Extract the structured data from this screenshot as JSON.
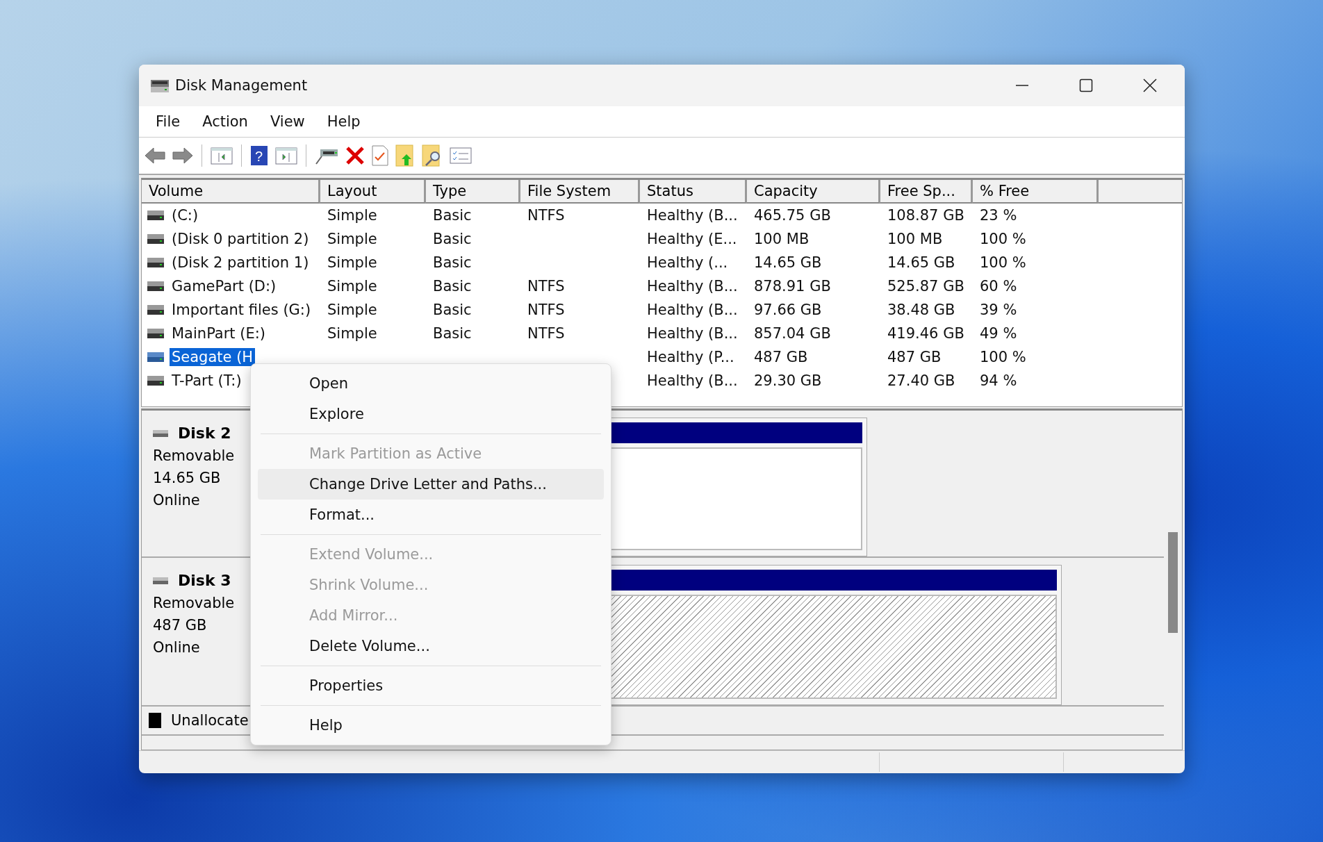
{
  "window": {
    "title": "Disk Management"
  },
  "menu_bar": [
    "File",
    "Action",
    "View",
    "Help"
  ],
  "toolbar": {
    "help_glyph": "?"
  },
  "table": {
    "columns": [
      "Volume",
      "Layout",
      "Type",
      "File System",
      "Status",
      "Capacity",
      "Free Sp...",
      "% Free"
    ],
    "rows": [
      {
        "volume": "(C:)",
        "layout": "Simple",
        "type": "Basic",
        "file_system": "NTFS",
        "status": "Healthy (B...",
        "capacity": "465.75 GB",
        "free_space": "108.87 GB",
        "percent_free": "23 %",
        "selected": false
      },
      {
        "volume": "(Disk 0 partition 2)",
        "layout": "Simple",
        "type": "Basic",
        "status": "Healthy (E...",
        "capacity": "100 MB",
        "free_space": "100 MB",
        "percent_free": "100 %",
        "selected": false
      },
      {
        "volume": "(Disk 2 partition 1)",
        "layout": "Simple",
        "type": "Basic",
        "status": "Healthy (...",
        "capacity": "14.65 GB",
        "free_space": "14.65 GB",
        "percent_free": "100 %",
        "selected": false
      },
      {
        "volume": "GamePart (D:)",
        "layout": "Simple",
        "type": "Basic",
        "file_system": "NTFS",
        "status": "Healthy (B...",
        "capacity": "878.91 GB",
        "free_space": "525.87 GB",
        "percent_free": "60 %",
        "selected": false
      },
      {
        "volume": "Important files (G:)",
        "layout": "Simple",
        "type": "Basic",
        "file_system": "NTFS",
        "status": "Healthy (B...",
        "capacity": "97.66 GB",
        "free_space": "38.48 GB",
        "percent_free": "39 %",
        "selected": false
      },
      {
        "volume": "MainPart (E:)",
        "layout": "Simple",
        "type": "Basic",
        "file_system": "NTFS",
        "status": "Healthy (B...",
        "capacity": "857.04 GB",
        "free_space": "419.46 GB",
        "percent_free": "49 %",
        "selected": false
      },
      {
        "volume": "Seagate (H",
        "status": "Healthy (P...",
        "capacity": "487 GB",
        "free_space": "487 GB",
        "percent_free": "100 %",
        "selected": true
      },
      {
        "volume": "T-Part (T:)",
        "status": "Healthy (B...",
        "capacity": "29.30 GB",
        "free_space": "27.40 GB",
        "percent_free": "94 %",
        "selected": false
      }
    ]
  },
  "disks": [
    {
      "name": "Disk 2",
      "type": "Removable",
      "size": "14.65 GB",
      "status": "Online",
      "partition": {
        "selected": false
      }
    },
    {
      "name": "Disk 3",
      "type": "Removable",
      "size": "487 GB",
      "status": "Online",
      "partition": {
        "selected": true
      }
    }
  ],
  "legend": [
    {
      "label": "Unallocate",
      "color": "#000000"
    }
  ],
  "context_menu": [
    {
      "kind": "item",
      "label": "Open",
      "disabled": false,
      "highlighted": false
    },
    {
      "kind": "item",
      "label": "Explore",
      "disabled": false,
      "highlighted": false
    },
    {
      "kind": "separator"
    },
    {
      "kind": "item",
      "label": "Mark Partition as Active",
      "disabled": true,
      "highlighted": false
    },
    {
      "kind": "item",
      "label": "Change Drive Letter and Paths...",
      "disabled": false,
      "highlighted": true
    },
    {
      "kind": "item",
      "label": "Format...",
      "disabled": false,
      "highlighted": false
    },
    {
      "kind": "separator"
    },
    {
      "kind": "item",
      "label": "Extend Volume...",
      "disabled": true,
      "highlighted": false
    },
    {
      "kind": "item",
      "label": "Shrink Volume...",
      "disabled": true,
      "highlighted": false
    },
    {
      "kind": "item",
      "label": "Add Mirror...",
      "disabled": true,
      "highlighted": false
    },
    {
      "kind": "item",
      "label": "Delete Volume...",
      "disabled": false,
      "highlighted": false
    },
    {
      "kind": "separator"
    },
    {
      "kind": "item",
      "label": "Properties",
      "disabled": false,
      "highlighted": false
    },
    {
      "kind": "separator"
    },
    {
      "kind": "item",
      "label": "Help",
      "disabled": false,
      "highlighted": false
    }
  ]
}
